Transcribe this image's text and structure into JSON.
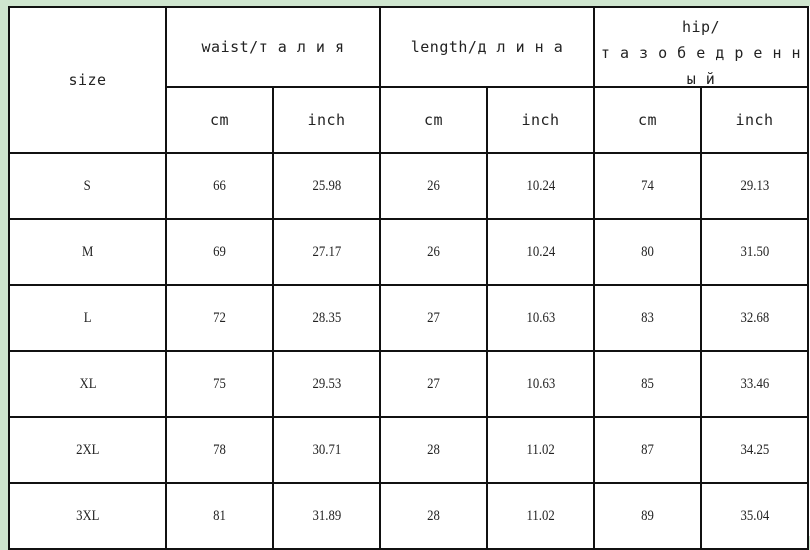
{
  "table": {
    "size_label": "size",
    "groups": [
      {
        "label": "waist/т а л и я"
      },
      {
        "label": "length/д л и н а"
      },
      {
        "label_line1": "hip/",
        "label_line2": "т а з о б е д р е н н",
        "label_line3": "ы й"
      }
    ],
    "units": [
      "cm",
      "inch",
      "cm",
      "inch",
      "cm",
      "inch"
    ],
    "rows": [
      {
        "size": "S",
        "waist_cm": "66",
        "waist_in": "25.98",
        "length_cm": "26",
        "length_in": "10.24",
        "hip_cm": "74",
        "hip_in": "29.13"
      },
      {
        "size": "M",
        "waist_cm": "69",
        "waist_in": "27.17",
        "length_cm": "26",
        "length_in": "10.24",
        "hip_cm": "80",
        "hip_in": "31.50"
      },
      {
        "size": "L",
        "waist_cm": "72",
        "waist_in": "28.35",
        "length_cm": "27",
        "length_in": "10.63",
        "hip_cm": "83",
        "hip_in": "32.68"
      },
      {
        "size": "XL",
        "waist_cm": "75",
        "waist_in": "29.53",
        "length_cm": "27",
        "length_in": "10.63",
        "hip_cm": "85",
        "hip_in": "33.46"
      },
      {
        "size": "2XL",
        "waist_cm": "78",
        "waist_in": "30.71",
        "length_cm": "28",
        "length_in": "11.02",
        "hip_cm": "87",
        "hip_in": "34.25"
      },
      {
        "size": "3XL",
        "waist_cm": "81",
        "waist_in": "31.89",
        "length_cm": "28",
        "length_in": "11.02",
        "hip_cm": "89",
        "hip_in": "35.04"
      }
    ]
  },
  "colors": {
    "sheet_background": "#cfe6cf",
    "grid_line": "#111111"
  }
}
